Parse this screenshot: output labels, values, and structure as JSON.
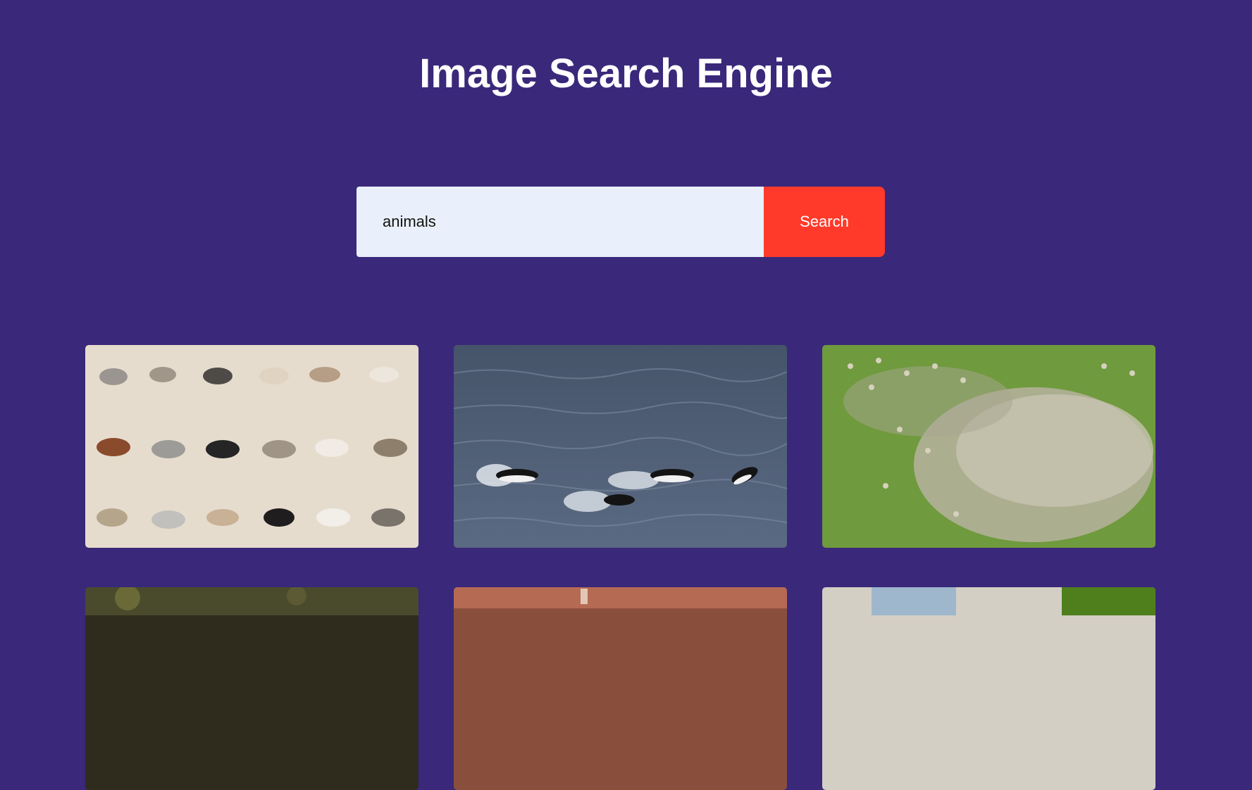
{
  "header": {
    "title": "Image Search Engine"
  },
  "search": {
    "value": "animals",
    "button_label": "Search"
  },
  "results": [
    {
      "subject": "horses painting"
    },
    {
      "subject": "penguins swimming"
    },
    {
      "subject": "sheep flock on grass"
    },
    {
      "subject": "dark foliage"
    },
    {
      "subject": "reddish scene"
    },
    {
      "subject": "window with trees"
    }
  ]
}
